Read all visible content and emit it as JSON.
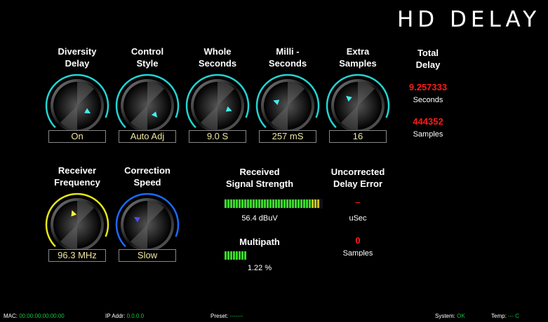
{
  "title": "HD DELAY",
  "knobs_top": [
    {
      "label1": "Diversity",
      "label2": "Delay",
      "value": "On",
      "angle": 120,
      "color": "#23d4d4",
      "ind": "#3ff0f0"
    },
    {
      "label1": "Control",
      "label2": "Style",
      "value": "Auto Adj",
      "angle": 140,
      "color": "#23d4d4",
      "ind": "#3ff0f0"
    },
    {
      "label1": "Whole",
      "label2": "Seconds",
      "value": "9.0 S",
      "angle": 110,
      "color": "#23d4d4",
      "ind": "#3ff0f0"
    },
    {
      "label1": "Milli -",
      "label2": "Seconds",
      "value": "257 mS",
      "angle": -70,
      "color": "#23d4d4",
      "ind": "#3ff0f0"
    },
    {
      "label1": "Extra",
      "label2": "Samples",
      "value": "16",
      "angle": -50,
      "color": "#23d4d4",
      "ind": "#3ff0f0"
    }
  ],
  "total_delay": {
    "label1": "Total",
    "label2": "Delay",
    "seconds": "9.257333",
    "seconds_unit": "Seconds",
    "samples": "444352",
    "samples_unit": "Samples"
  },
  "knobs_bottom": [
    {
      "label1": "Receiver",
      "label2": "Frequency",
      "value": "96.3 MHz",
      "angle": -20,
      "color": "#e6e61a",
      "ind": "#ffff33"
    },
    {
      "label1": "Correction",
      "label2": "Speed",
      "value": "Slow",
      "angle": -60,
      "color": "#1a6aff",
      "ind": "#4d4dff"
    }
  ],
  "signal": {
    "label1": "Received",
    "label2": "Signal Strength",
    "value": "56.4 dBuV",
    "level_pct": 100
  },
  "multipath": {
    "label": "Multipath",
    "value": "1.22 %",
    "level_pct": 8
  },
  "uncorrected": {
    "label1": "Uncorrected",
    "label2": "Delay Error",
    "usec_unit": "uSec",
    "samples_value": "0",
    "samples_unit": "Samples"
  },
  "status_bar": {
    "mac_label": "MAC:",
    "mac_value": "00:00:00:00:00:00",
    "ip_label": "IP Addr:",
    "ip_value": "0.0.0.0",
    "preset_label": "Preset:",
    "preset_value": "-------",
    "system_label": "System:",
    "system_value": "OK",
    "temp_label": "Temp:",
    "temp_value": "--- C"
  }
}
